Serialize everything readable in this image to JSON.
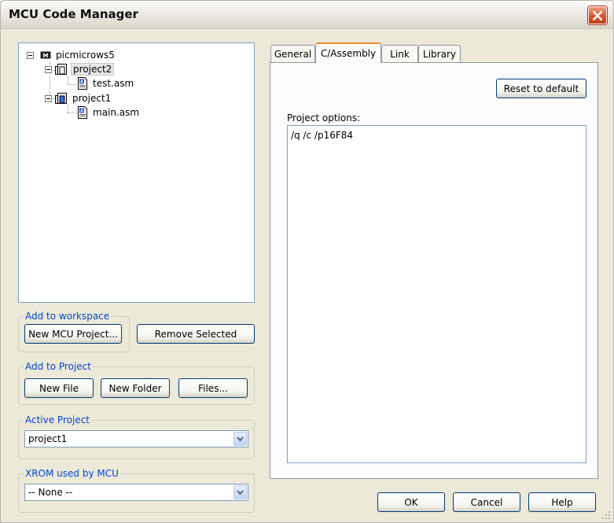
{
  "window": {
    "title": "MCU Code Manager"
  },
  "tree": {
    "root": {
      "label": "picmicrows5",
      "icon": "mcu-chip-icon"
    },
    "projects": [
      {
        "label": "project2",
        "icon": "project-icon",
        "selected": true,
        "files": [
          {
            "label": "test.asm",
            "icon": "asm-file-icon"
          }
        ]
      },
      {
        "label": "project1",
        "icon": "active-project-icon",
        "selected": false,
        "files": [
          {
            "label": "main.asm",
            "icon": "asm-file-icon"
          }
        ]
      }
    ]
  },
  "workspace_group": {
    "legend": "Add to workspace",
    "new_mcu_project": "New MCU Project...",
    "remove_selected": "Remove Selected"
  },
  "project_group": {
    "legend": "Add to Project",
    "new_file": "New File",
    "new_folder": "New Folder",
    "files": "Files..."
  },
  "active_project": {
    "legend": "Active Project",
    "value": "project1"
  },
  "xrom": {
    "legend": "XROM used by MCU",
    "value": "-- None --"
  },
  "tabs": [
    {
      "label": "General",
      "active": false
    },
    {
      "label": "C/Assembly",
      "active": true
    },
    {
      "label": "Link",
      "active": false
    },
    {
      "label": "Library",
      "active": false
    }
  ],
  "options": {
    "reset_label": "Reset to default",
    "project_options_label": "Project options:",
    "project_options_value": "/q /c /p16F84"
  },
  "footer": {
    "ok": "OK",
    "cancel": "Cancel",
    "help": "Help"
  },
  "colors": {
    "legend": "#0046d5",
    "active_tab_accent": "#e68b2c",
    "close_button": "#d9542f"
  }
}
